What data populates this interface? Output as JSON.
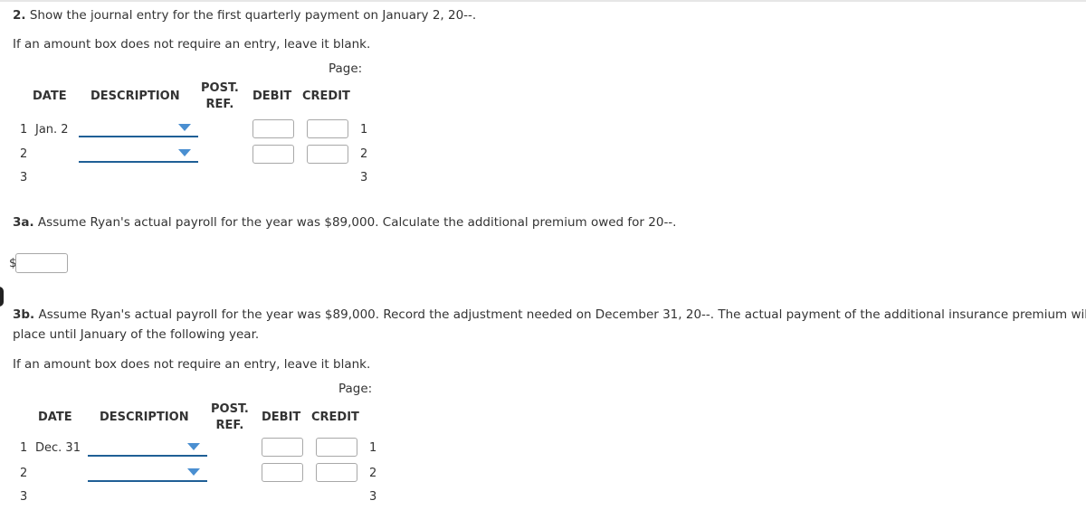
{
  "q2": {
    "number": "2.",
    "text": " Show the journal entry for the first quarterly payment on January 2, 20--.",
    "instruction": "If an amount box does not require an entry, leave it blank.",
    "journal": {
      "page_label": "Page:",
      "headers": {
        "date": "DATE",
        "description": "DESCRIPTION",
        "post_ref_1": "POST.",
        "post_ref_2": "REF.",
        "debit": "DEBIT",
        "credit": "CREDIT"
      },
      "rows": [
        {
          "line": "1",
          "date": "Jan. 2",
          "has_inputs": true,
          "description": "",
          "debit": "",
          "credit": ""
        },
        {
          "line": "2",
          "date": "",
          "has_inputs": true,
          "description": "",
          "debit": "",
          "credit": ""
        },
        {
          "line": "3",
          "date": "",
          "has_inputs": false
        }
      ]
    }
  },
  "q3a": {
    "number": "3a.",
    "text": " Assume Ryan's actual payroll for the year was $89,000. Calculate the additional premium owed for 20--.",
    "currency": "$",
    "value": ""
  },
  "q3b": {
    "number": "3b.",
    "text_line1": " Assume Ryan's actual payroll for the year was $89,000. Record the adjustment needed on December 31, 20--. The actual payment of the additional insurance premium will not take",
    "text_line2": "place until January of the following year.",
    "instruction": "If an amount box does not require an entry, leave it blank.",
    "journal": {
      "page_label": "Page:",
      "headers": {
        "date": "DATE",
        "description": "DESCRIPTION",
        "post_ref_1": "POST.",
        "post_ref_2": "REF.",
        "debit": "DEBIT",
        "credit": "CREDIT"
      },
      "rows": [
        {
          "line": "1",
          "date": "Dec. 31",
          "has_inputs": true,
          "description": "",
          "debit": "",
          "credit": ""
        },
        {
          "line": "2",
          "date": "",
          "has_inputs": true,
          "description": "",
          "debit": "",
          "credit": ""
        },
        {
          "line": "3",
          "date": "",
          "has_inputs": false
        }
      ]
    }
  },
  "colors": {
    "dropdown_line": "#1f5f96",
    "dropdown_arrow": "#4a8fd1",
    "input_border": "#a8a8a8"
  }
}
